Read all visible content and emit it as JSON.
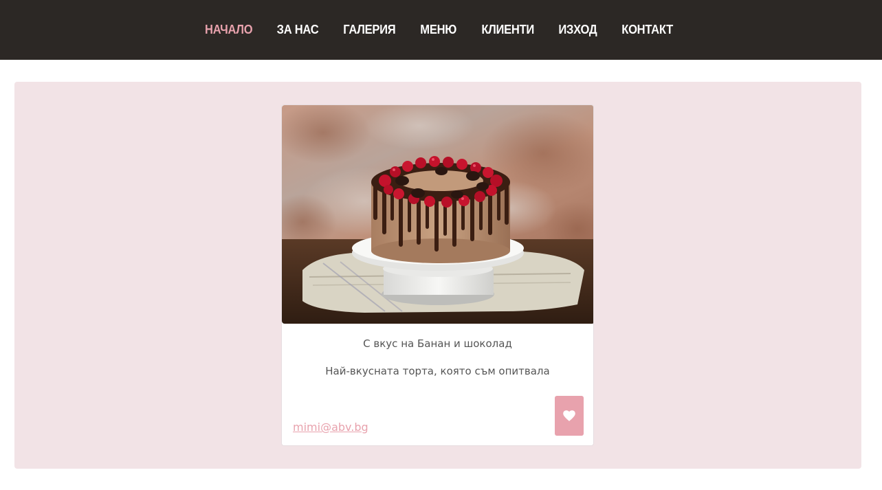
{
  "nav": {
    "items": [
      {
        "label": "НАЧАЛО",
        "active": true
      },
      {
        "label": "ЗА НАС",
        "active": false
      },
      {
        "label": "ГАЛЕРИЯ",
        "active": false
      },
      {
        "label": "МЕНЮ",
        "active": false
      },
      {
        "label": "КЛИЕНТИ",
        "active": false
      },
      {
        "label": "ИЗХОД",
        "active": false
      },
      {
        "label": "КОНТАКТ",
        "active": false
      }
    ]
  },
  "card": {
    "image": "chocolate-drip-cake-with-raspberries-photo",
    "title": "С вкус на Банан и шоколад",
    "text": "Най-вкусната торта, която съм опитвала",
    "email": "mimi@abv.bg",
    "like_icon": "heart-icon"
  },
  "colors": {
    "navbar_bg": "#2c2825",
    "nav_active": "#e8a2ad",
    "panel_bg": "#f2e3e6",
    "accent": "#e8a2ad"
  }
}
